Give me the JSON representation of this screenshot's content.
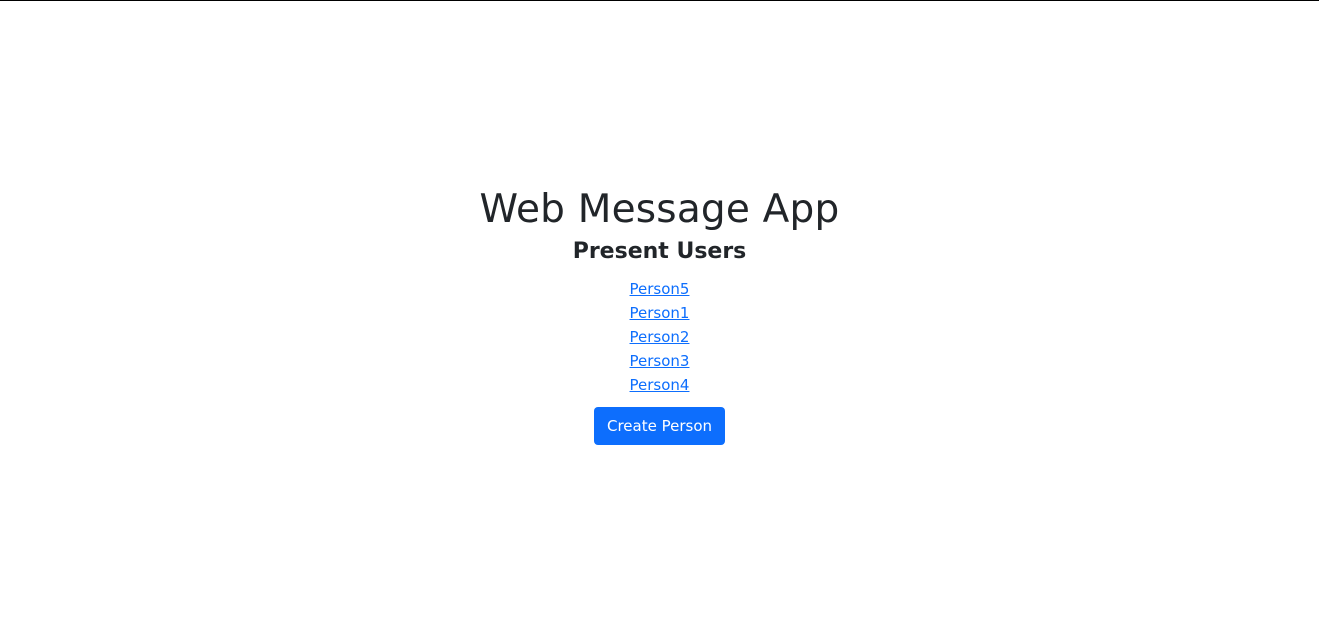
{
  "header": {
    "title": "Web Message App"
  },
  "users_section": {
    "title": "Present Users",
    "users": [
      {
        "label": "Person5"
      },
      {
        "label": "Person1"
      },
      {
        "label": "Person2"
      },
      {
        "label": "Person3"
      },
      {
        "label": "Person4"
      }
    ]
  },
  "actions": {
    "create_person_label": "Create Person"
  },
  "colors": {
    "link": "#0d6efd",
    "primary_button": "#0d6efd",
    "text": "#212529",
    "background": "#ffffff"
  }
}
